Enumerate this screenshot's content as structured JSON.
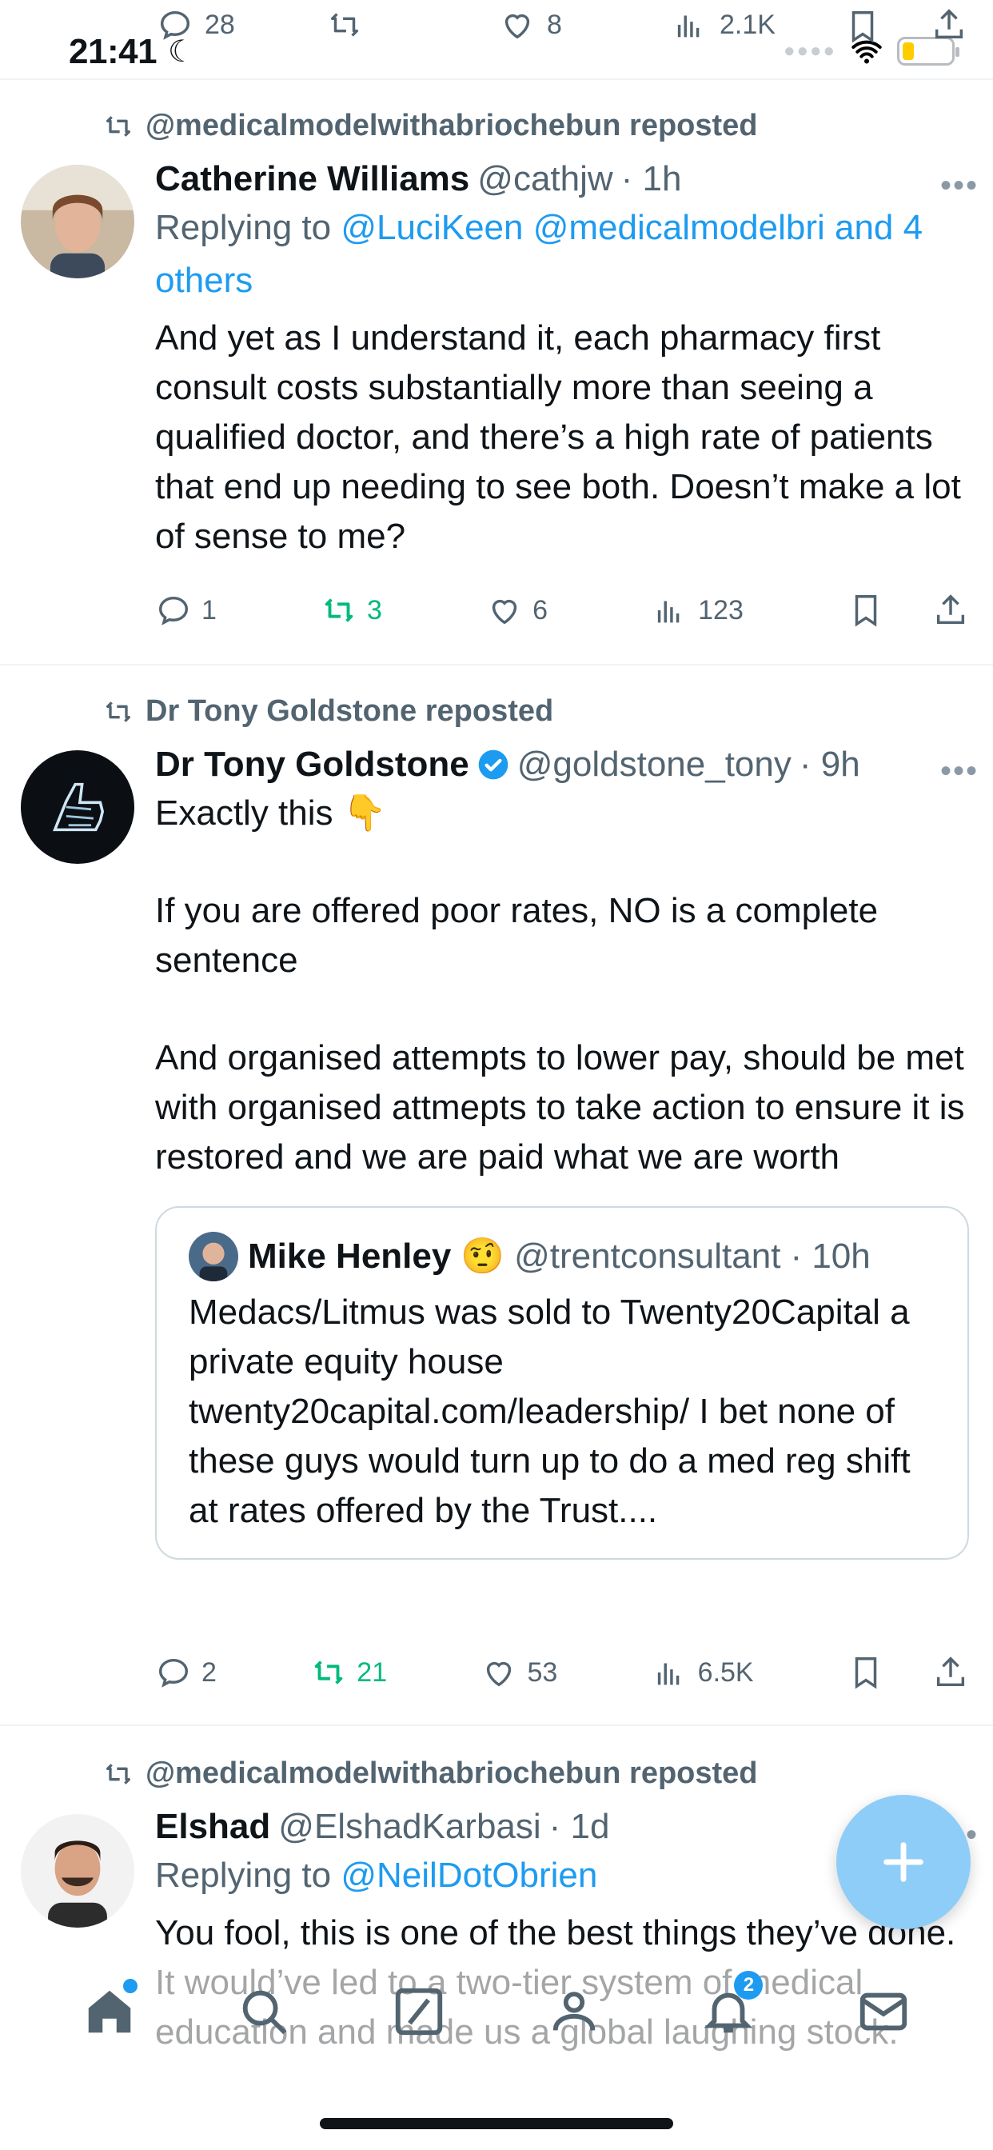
{
  "status_bar": {
    "time": "21:41"
  },
  "previous_tweet_actions": {
    "replies": "28",
    "likes": "8",
    "views": "2.1K"
  },
  "tweets": [
    {
      "repost_by": "@medicalmodelwithabriochebun reposted",
      "name": "Catherine Williams",
      "handle": "@cathjw",
      "time": "· 1h",
      "replying_prefix": "Replying to ",
      "replying_to": "@LuciKeen @medicalmodelbri and 4 others",
      "text": "And yet as I understand it, each pharmacy first consult costs substantially more than seeing a qualified doctor, and there’s a high rate of patients that end up needing to see both. Doesn’t make a lot of sense to me?",
      "replies": "1",
      "reposts": "3",
      "likes": "6",
      "views": "123"
    },
    {
      "repost_by": "Dr Tony Goldstone reposted",
      "name": "Dr Tony Goldstone",
      "handle": "@goldstone_tony",
      "time": "· 9h",
      "text_line1": "Exactly this 👇",
      "text_line2": "If you are offered poor rates, NO is a complete sentence",
      "text_line3": "And organised attempts to lower pay, should be met with organised attmepts to take action to ensure it is restored and we are paid what we are worth",
      "quote": {
        "name": "Mike Henley",
        "emoji": "🤨",
        "handle": "@trentconsultant",
        "time": "· 10h",
        "text": "Medacs/Litmus was sold to Twenty20Capital a private equity house twenty20capital.com/leadership/ I bet none of these guys would turn up to do a med reg shift at rates offered by the Trust...."
      },
      "replies": "2",
      "reposts": "21",
      "likes": "53",
      "views": "6.5K"
    },
    {
      "repost_by": "@medicalmodelwithabriochebun reposted",
      "name": "Elshad",
      "handle": "@ElshadKarbasi",
      "time": "· 1d",
      "replying_prefix": "Replying to ",
      "replying_to": "@NeilDotObrien",
      "text": "You fool, this is one of the best things they’ve done. It would’ve led to a two-tier system of medical education and made us a global laughing stock."
    }
  ],
  "bottom_nav": {
    "notification_badge": "2"
  },
  "colors": {
    "accent": "#1d9bf0",
    "repost_green": "#00ba7c",
    "secondary_text": "#536471"
  }
}
